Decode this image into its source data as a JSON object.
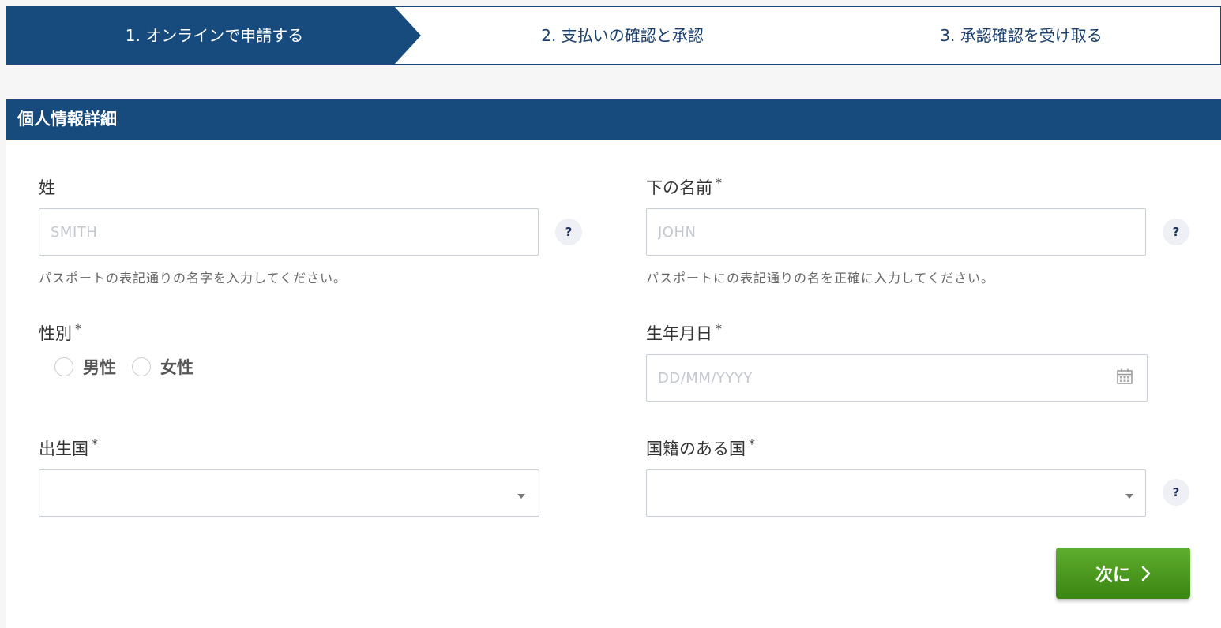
{
  "steps": [
    {
      "label": "1. オンラインで申請する",
      "active": true
    },
    {
      "label": "2. 支払いの確認と承認",
      "active": false
    },
    {
      "label": "3. 承認確認を受け取る",
      "active": false
    }
  ],
  "section": {
    "title": "個人情報詳細"
  },
  "form": {
    "surname": {
      "label": "姓",
      "placeholder": "SMITH",
      "hint": "パスポートの表記通りの名字を入力してください。",
      "help": "?"
    },
    "given_name": {
      "label": "下の名前",
      "required": "*",
      "placeholder": "JOHN",
      "hint": "パスポートにの表記通りの名を正確に入力してください。",
      "help": "?"
    },
    "gender": {
      "label": "性別",
      "required": "*",
      "options": [
        "男性",
        "女性"
      ]
    },
    "dob": {
      "label": "生年月日",
      "required": "*",
      "placeholder": "DD/MM/YYYY",
      "icon": "calendar-icon"
    },
    "birth_country": {
      "label": "出生国",
      "required": "*",
      "value": ""
    },
    "nationality": {
      "label": "国籍のある国",
      "required": "*",
      "value": "",
      "help": "?"
    }
  },
  "next_button": {
    "label": "次に",
    "icon": "chevron-right-icon"
  },
  "colors": {
    "primary": "#174a7d",
    "button_green": "#4a9a1f",
    "help_bg": "#eef0f5"
  }
}
